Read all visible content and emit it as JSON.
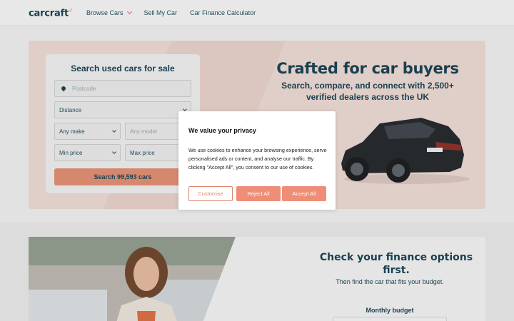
{
  "header": {
    "logo": "carcraft",
    "nav": [
      {
        "label": "Browse Cars",
        "has_dropdown": true
      },
      {
        "label": "Sell My Car",
        "has_dropdown": false
      },
      {
        "label": "Car Finance Calculator",
        "has_dropdown": false
      }
    ]
  },
  "search": {
    "title": "Search used cars for sale",
    "postcode_placeholder": "Postcode",
    "distance": "Distance",
    "make": "Any make",
    "model": "Any model",
    "min_price": "Min price",
    "max_price": "Max price",
    "button": "Search 99,593 cars"
  },
  "hero": {
    "title": "Crafted for car buyers",
    "subtitle": "Search, compare, and connect with 2,500+ verified dealers across the UK"
  },
  "finance": {
    "title": "Check your finance options first.",
    "subtitle": "Then find the car that fits your budget.",
    "monthly_label": "Monthly budget"
  },
  "cookie": {
    "title": "We value your privacy",
    "body": "We use cookies to enhance your browsing experience, serve personalised ads or content, and analyse our traffic. By clicking \"Accept All\", you consent to our use of cookies.",
    "customise": "Customise",
    "reject": "Reject All",
    "accept": "Accept All"
  },
  "colors": {
    "brand": "#123c4d",
    "accent": "#e0846b",
    "hero_bg": "#ead6d0"
  }
}
